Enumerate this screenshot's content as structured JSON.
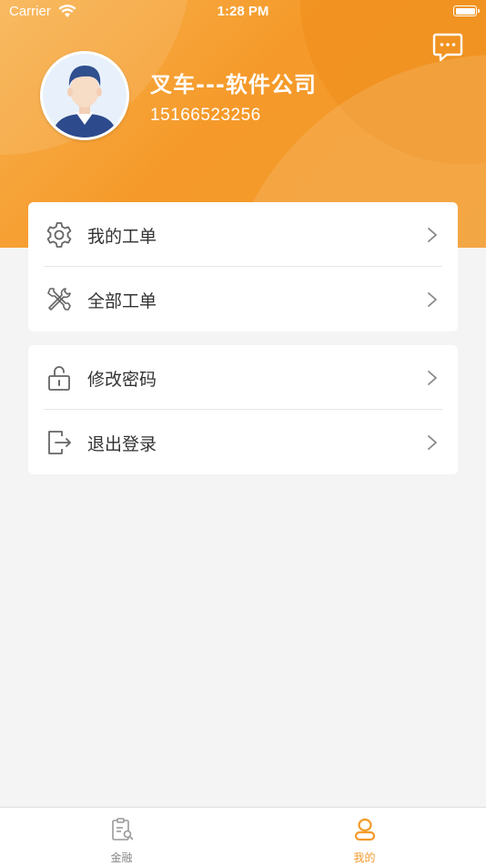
{
  "status_bar": {
    "carrier": "Carrier",
    "time": "1:28 PM"
  },
  "profile": {
    "name": "叉车---软件公司",
    "phone": "15166523256"
  },
  "menu": {
    "group1": [
      {
        "label": "我的工单",
        "icon": "gear-icon"
      },
      {
        "label": "全部工单",
        "icon": "tools-icon"
      }
    ],
    "group2": [
      {
        "label": "修改密码",
        "icon": "unlock-icon"
      },
      {
        "label": "退出登录",
        "icon": "logout-icon"
      }
    ]
  },
  "tabbar": {
    "tabs": [
      {
        "label": "金融",
        "icon": "clipboard-icon",
        "active": false
      },
      {
        "label": "我的",
        "icon": "person-icon",
        "active": true
      }
    ]
  },
  "colors": {
    "accent": "#f39a2a",
    "header_start": "#f8b24f",
    "header_end": "#f29a2b",
    "background": "#f4f4f4"
  }
}
